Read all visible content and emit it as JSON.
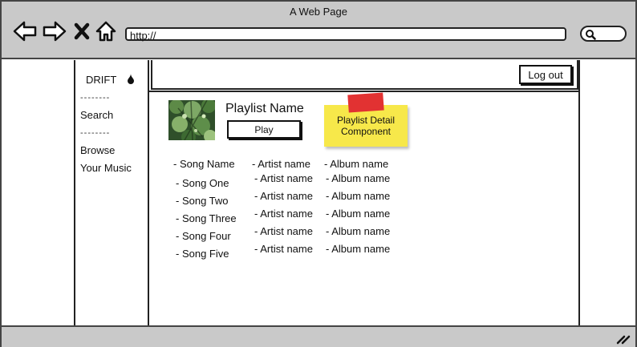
{
  "window": {
    "title": "A Web Page"
  },
  "address_bar": {
    "url": "http://"
  },
  "sidebar": {
    "brand": "DRIFT",
    "dividers": [
      "--------",
      "--------"
    ],
    "items": [
      "Search",
      "Browse",
      "Your Music"
    ]
  },
  "header": {
    "logout_label": "Log out"
  },
  "playlist": {
    "name": "Playlist Name",
    "play_label": "Play",
    "note_line1": "Playlist Detail",
    "note_line2": "Component"
  },
  "table": {
    "columns": [
      "- Song Name",
      "- Artist name",
      "- Album name"
    ],
    "rows": [
      [
        "- Song One",
        "- Artist name",
        "- Album name"
      ],
      [
        "- Song Two",
        "- Artist name",
        "- Album name"
      ],
      [
        "- Song Three",
        "- Artist name",
        "- Album name"
      ],
      [
        "- Song Four",
        "- Artist name",
        "- Album name"
      ],
      [
        "- Song Five",
        "- Artist name",
        "- Album name"
      ]
    ]
  },
  "colors": {
    "chrome": "#c9c9c9",
    "sticky": "#f7e84a",
    "tape": "#e23232"
  }
}
